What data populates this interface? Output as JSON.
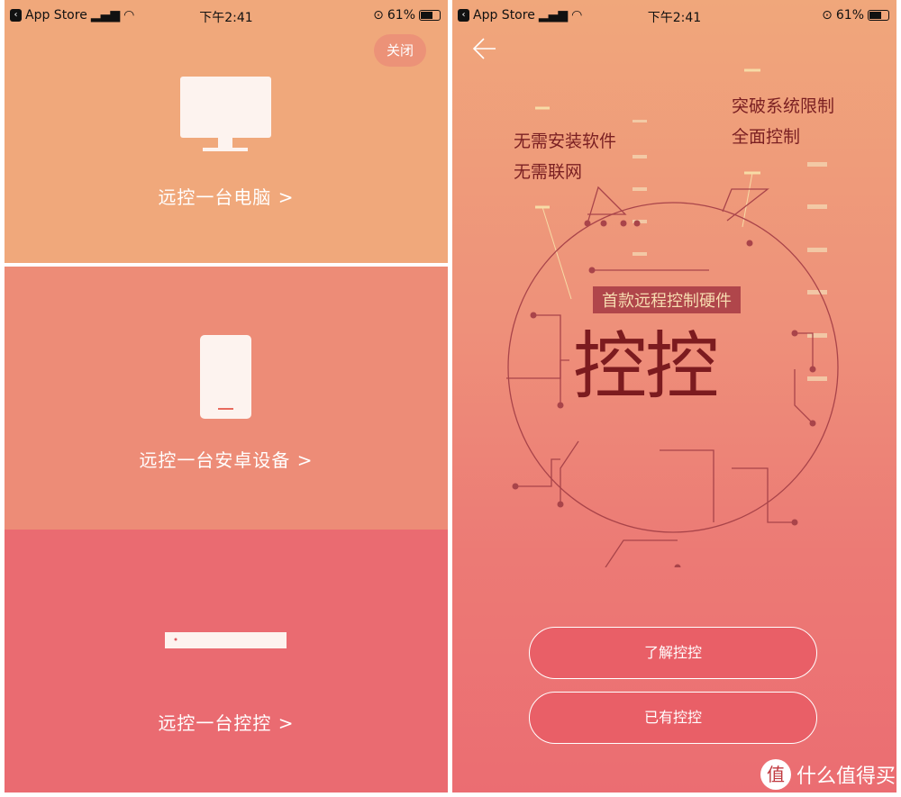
{
  "status_bar": {
    "back_app": "App Store",
    "time": "下午2:41",
    "battery": "61%"
  },
  "left": {
    "close_label": "关闭",
    "options": [
      {
        "label": "远控一台电脑  >",
        "icon": "monitor-icon",
        "color": "#f0a87b"
      },
      {
        "label": "远控一台安卓设备  >",
        "icon": "phone-icon",
        "color": "#ed8c77"
      },
      {
        "label": "远控一台控控  >",
        "icon": "device-icon",
        "color": "#ea6b71"
      }
    ]
  },
  "right": {
    "tag_left": [
      "无需安装软件",
      "无需联网"
    ],
    "tag_right": [
      "突破系统限制",
      "全面控制"
    ],
    "banner": "首款远程控制硬件",
    "logo_text": "控控",
    "learn_button": "了解控控",
    "have_button": "已有控控"
  },
  "watermark": {
    "badge": "值",
    "text": "什么值得买"
  }
}
